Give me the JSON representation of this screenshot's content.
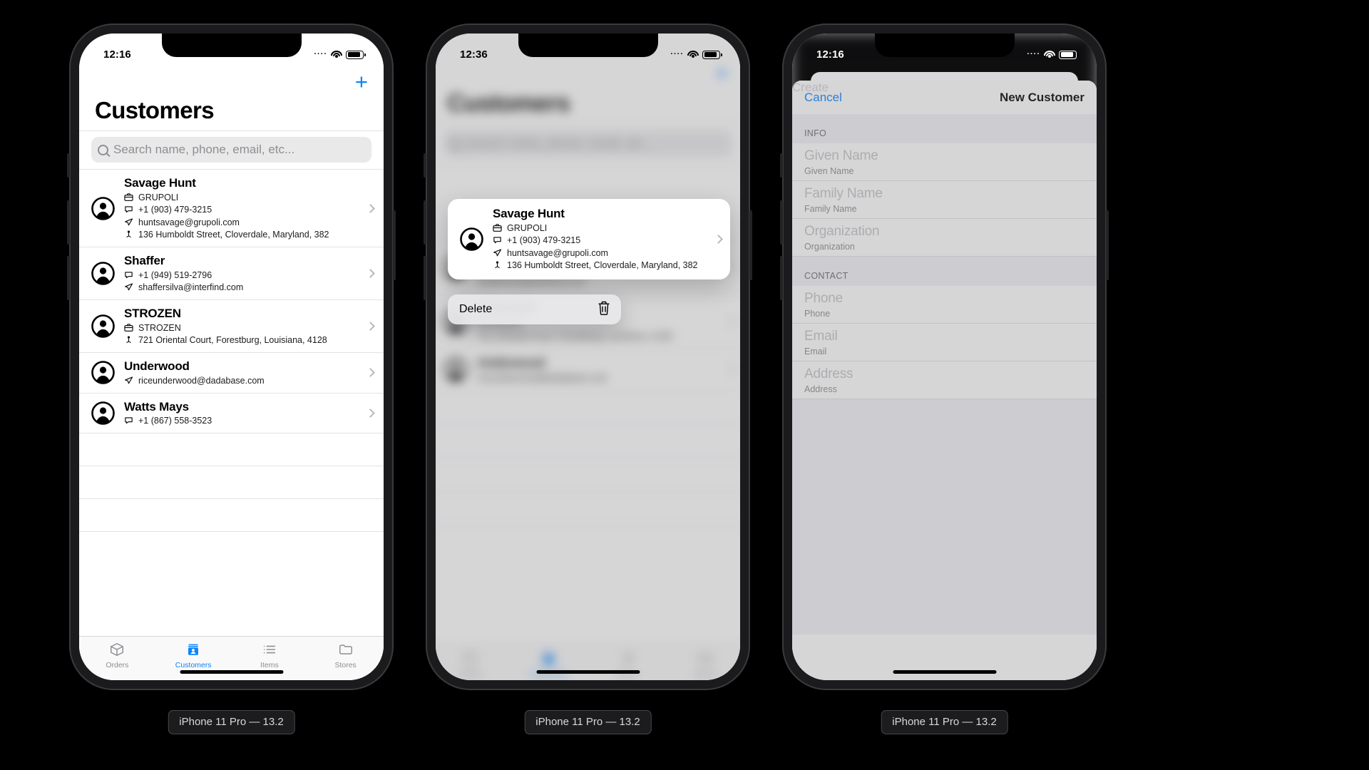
{
  "devices": [
    {
      "caption": "iPhone 11 Pro — 13.2",
      "status_time": "12:16"
    },
    {
      "caption": "iPhone 11 Pro — 13.2",
      "status_time": "12:36"
    },
    {
      "caption": "iPhone 11 Pro — 13.2",
      "status_time": "12:16"
    }
  ],
  "colors": {
    "accent": "#0a84ff",
    "secondary_text": "#8e8e93",
    "separator": "#e3e3e5",
    "group_bg": "#f2f2f7"
  },
  "screen1": {
    "add_button": "+",
    "title": "Customers",
    "search": {
      "placeholder": "Search name, phone, email, etc...",
      "icon": "search-icon"
    },
    "customers": [
      {
        "name": "Savage Hunt",
        "organization": "GRUPOLI",
        "phone": "+1 (903) 479-3215",
        "email": "huntsavage@grupoli.com",
        "address": "136 Humboldt Street, Cloverdale, Maryland, 382"
      },
      {
        "name": "Shaffer",
        "phone": "+1 (949) 519-2796",
        "email": "shaffersilva@interfind.com"
      },
      {
        "name": "STROZEN",
        "organization": "STROZEN",
        "address": "721 Oriental Court, Forestburg, Louisiana, 4128"
      },
      {
        "name": "Underwood",
        "email": "riceunderwood@dadabase.com"
      },
      {
        "name": "Watts Mays",
        "phone": "+1 (867) 558-3523"
      }
    ],
    "tabs": [
      {
        "label": "Orders",
        "icon": "box-icon",
        "active": false
      },
      {
        "label": "Customers",
        "icon": "customers-icon",
        "active": true
      },
      {
        "label": "Items",
        "icon": "list-icon",
        "active": false
      },
      {
        "label": "Stores",
        "icon": "folder-icon",
        "active": false
      }
    ]
  },
  "screen2": {
    "title": "Customers",
    "highlighted_customer": {
      "name": "Savage Hunt",
      "organization": "GRUPOLI",
      "phone": "+1 (903) 479-3215",
      "email": "huntsavage@grupoli.com",
      "address": "136 Humboldt Street, Cloverdale, Maryland, 382"
    },
    "context_menu": {
      "delete_label": "Delete",
      "delete_icon": "trash-icon"
    },
    "tabs": [
      {
        "label": "Orders",
        "active": false
      },
      {
        "label": "Customers",
        "active": true
      },
      {
        "label": "Items",
        "active": false
      },
      {
        "label": "Stores",
        "active": false
      }
    ]
  },
  "screen3": {
    "nav": {
      "cancel": "Cancel",
      "title": "New Customer",
      "create": "Create"
    },
    "sections": [
      {
        "header": "INFO",
        "fields": [
          {
            "placeholder": "Given Name",
            "label": "Given Name",
            "value": ""
          },
          {
            "placeholder": "Family Name",
            "label": "Family Name",
            "value": ""
          },
          {
            "placeholder": "Organization",
            "label": "Organization",
            "value": ""
          }
        ]
      },
      {
        "header": "CONTACT",
        "fields": [
          {
            "placeholder": "Phone",
            "label": "Phone",
            "value": ""
          },
          {
            "placeholder": "Email",
            "label": "Email",
            "value": ""
          },
          {
            "placeholder": "Address",
            "label": "Address",
            "value": ""
          }
        ]
      }
    ]
  }
}
